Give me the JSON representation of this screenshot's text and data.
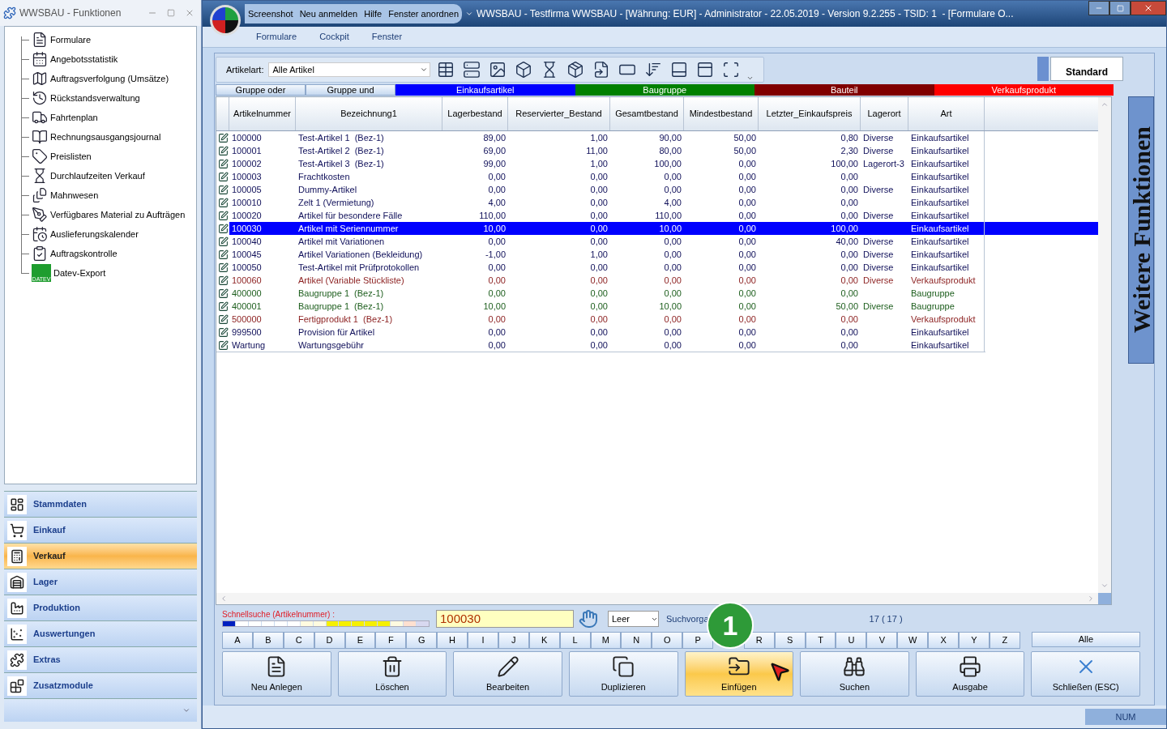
{
  "side_panel": {
    "title": "WWSBAU - Funktionen",
    "tree_items": [
      {
        "label": "Formulare"
      },
      {
        "label": "Angebotsstatistik"
      },
      {
        "label": "Auftragsverfolgung (Umsätze)"
      },
      {
        "label": "Rückstandsverwaltung"
      },
      {
        "label": "Fahrtenplan"
      },
      {
        "label": "Rechnungsausgangsjournal"
      },
      {
        "label": "Preislisten"
      },
      {
        "label": "Durchlaufzeiten Verkauf"
      },
      {
        "label": "Mahnwesen"
      },
      {
        "label": "Verfügbares Material zu Aufträgen"
      },
      {
        "label": "Auslieferungskalender"
      },
      {
        "label": "Auftragskontrolle"
      },
      {
        "label": "Datev-Export",
        "icon_caption": "DATEV"
      }
    ],
    "nav_items": [
      {
        "label": "Stammdaten",
        "selected": false
      },
      {
        "label": "Einkauf",
        "selected": false
      },
      {
        "label": "Verkauf",
        "selected": true
      },
      {
        "label": "Lager",
        "selected": false
      },
      {
        "label": "Produktion",
        "selected": false
      },
      {
        "label": "Auswertungen",
        "selected": false
      },
      {
        "label": "Extras",
        "selected": false
      },
      {
        "label": "Zusatzmodule",
        "selected": false
      }
    ]
  },
  "window": {
    "quick_toolbar": [
      "Screenshot",
      "Neu anmelden",
      "Hilfe",
      "Fenster anordnen"
    ],
    "title": "WWSBAU - Testfirma WWSBAU - [Währung: EUR] - Administrator - 22.05.2019 - Version 9.2.255 - TSID: 1  - [Formulare O...",
    "menu": [
      "Formulare",
      "Cockpit",
      "Fenster"
    ]
  },
  "toolbar": {
    "filter_label": "Artikelart:",
    "filter_value": "Alle Artikel",
    "standard_button": "Standard"
  },
  "legend": [
    {
      "label": "Gruppe oder",
      "kind": "button"
    },
    {
      "label": "Gruppe und",
      "kind": "button"
    },
    {
      "label": "Einkaufsartikel",
      "kind": "band",
      "color": "#0000ff"
    },
    {
      "label": "Baugruppe",
      "kind": "band",
      "color": "#008000"
    },
    {
      "label": "Bauteil",
      "kind": "band",
      "color": "#800000"
    },
    {
      "label": "Verkaufsprodukt",
      "kind": "band",
      "color": "#ff0000"
    }
  ],
  "table": {
    "columns": [
      "Artikelnummer",
      "Bezeichnung1",
      "Lagerbestand",
      "Reservierter_Bestand",
      "Gesamtbestand",
      "Mindestbestand",
      "Letzter_Einkaufspreis",
      "Lagerort",
      "Art"
    ],
    "rows": [
      {
        "kind": "einkauf",
        "selected": false,
        "cells": [
          "100000",
          "Test-Artikel 1  (Bez-1)",
          "89,00",
          "1,00",
          "90,00",
          "50,00",
          "0,80",
          "Diverse",
          "Einkaufsartikel"
        ]
      },
      {
        "kind": "einkauf",
        "selected": false,
        "cells": [
          "100001",
          "Test-Artikel 2  (Bez-1)",
          "69,00",
          "11,00",
          "80,00",
          "50,00",
          "2,30",
          "Diverse",
          "Einkaufsartikel"
        ]
      },
      {
        "kind": "einkauf",
        "selected": false,
        "cells": [
          "100002",
          "Test-Artikel 3  (Bez-1)",
          "99,00",
          "1,00",
          "100,00",
          "0,00",
          "100,00",
          "Lagerort-3",
          "Einkaufsartikel"
        ]
      },
      {
        "kind": "einkauf",
        "selected": false,
        "cells": [
          "100003",
          "Frachtkosten",
          "0,00",
          "0,00",
          "0,00",
          "0,00",
          "0,00",
          null,
          "Einkaufsartikel"
        ]
      },
      {
        "kind": "einkauf",
        "selected": false,
        "cells": [
          "100005",
          "Dummy-Artikel",
          "0,00",
          "0,00",
          "0,00",
          "0,00",
          "0,00",
          "Diverse",
          "Einkaufsartikel"
        ]
      },
      {
        "kind": "einkauf",
        "selected": false,
        "cells": [
          "100010",
          "Zelt 1 (Vermietung)",
          "4,00",
          "0,00",
          "4,00",
          "0,00",
          "0,00",
          null,
          "Einkaufsartikel"
        ]
      },
      {
        "kind": "einkauf",
        "selected": false,
        "cells": [
          "100020",
          "Artikel für besondere Fälle",
          "110,00",
          "0,00",
          "110,00",
          "0,00",
          "0,00",
          "Diverse",
          "Einkaufsartikel"
        ]
      },
      {
        "kind": "einkauf",
        "selected": true,
        "cells": [
          "100030",
          "Artikel mit Seriennummer",
          "10,00",
          "0,00",
          "10,00",
          "0,00",
          "100,00",
          null,
          "Einkaufsartikel"
        ]
      },
      {
        "kind": "einkauf",
        "selected": false,
        "cells": [
          "100040",
          "Artikel mit Variationen",
          "0,00",
          "0,00",
          "0,00",
          "0,00",
          "40,00",
          "Diverse",
          "Einkaufsartikel"
        ]
      },
      {
        "kind": "einkauf",
        "selected": false,
        "cells": [
          "100045",
          "Artikel Variationen (Bekleidung)",
          "-1,00",
          "1,00",
          "0,00",
          "0,00",
          "0,00",
          "Diverse",
          "Einkaufsartikel"
        ]
      },
      {
        "kind": "einkauf",
        "selected": false,
        "cells": [
          "100050",
          "Test-Artikel mit Prüfprotokollen",
          "0,00",
          "0,00",
          "0,00",
          "0,00",
          "0,00",
          "Diverse",
          "Einkaufsartikel"
        ]
      },
      {
        "kind": "verkauf",
        "selected": false,
        "cells": [
          "100060",
          "Artikel (Variable Stückliste)",
          "0,00",
          "0,00",
          "0,00",
          "0,00",
          "0,00",
          "Diverse",
          "Verkaufsprodukt"
        ]
      },
      {
        "kind": "baugruppe",
        "selected": false,
        "cells": [
          "400000",
          "Baugruppe 1  (Bez-1)",
          "0,00",
          "0,00",
          "0,00",
          "0,00",
          "0,00",
          null,
          "Baugruppe"
        ]
      },
      {
        "kind": "baugruppe",
        "selected": false,
        "cells": [
          "400001",
          "Baugruppe 1  (Bez-1)",
          "10,00",
          "0,00",
          "10,00",
          "0,00",
          "50,00",
          "Diverse",
          "Baugruppe"
        ]
      },
      {
        "kind": "verkauf",
        "selected": false,
        "cells": [
          "500000",
          "Fertigprodukt 1  (Bez-1)",
          "0,00",
          "0,00",
          "0,00",
          "0,00",
          "0,00",
          null,
          "Verkaufsprodukt"
        ]
      },
      {
        "kind": "einkauf",
        "selected": false,
        "cells": [
          "999500",
          "Provision für Artikel",
          "0,00",
          "0,00",
          "0,00",
          "0,00",
          "0,00",
          null,
          "Einkaufsartikel"
        ]
      },
      {
        "kind": "einkauf",
        "selected": false,
        "cells": [
          "Wartung",
          "Wartungsgebühr",
          "0,00",
          "0,00",
          "0,00",
          "0,00",
          "0,00",
          null,
          "Einkaufsartikel"
        ]
      }
    ]
  },
  "side_tab": "Weitere Funktionen",
  "quick_search": {
    "label": "Schnellsuche (Artikelnummer) :",
    "value": "100030",
    "mode": "Leer",
    "preset_label": "Suchvorga",
    "count": "17 ( 17 )"
  },
  "letters": [
    "A",
    "B",
    "C",
    "D",
    "E",
    "F",
    "G",
    "H",
    "I",
    "J",
    "K",
    "L",
    "M",
    "N",
    "O",
    "P",
    "R",
    "S",
    "T",
    "U",
    "V",
    "W",
    "X",
    "Y",
    "Z"
  ],
  "all_button": "Alle",
  "step_badge": "1",
  "actions": [
    {
      "label": "Neu Anlegen",
      "selected": false
    },
    {
      "label": "Löschen",
      "selected": false
    },
    {
      "label": "Bearbeiten",
      "selected": false
    },
    {
      "label": "Duplizieren",
      "selected": false
    },
    {
      "label": "Einfügen",
      "selected": true
    },
    {
      "label": "Suchen",
      "selected": false
    },
    {
      "label": "Ausgabe",
      "selected": false
    },
    {
      "label": "Schließen (ESC)",
      "selected": false
    }
  ],
  "status_bar": {
    "indicator": "NUM"
  }
}
